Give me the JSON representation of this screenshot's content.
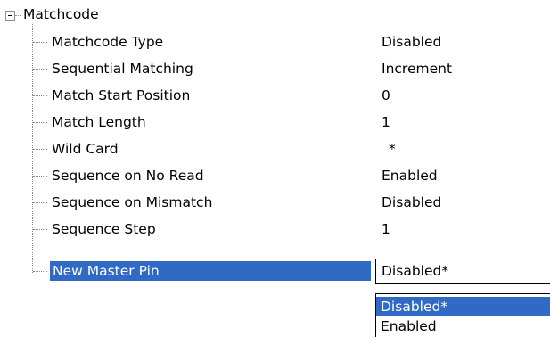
{
  "tree": {
    "root_label": "Matchcode",
    "items": [
      {
        "label": "Matchcode Type",
        "value": "Disabled"
      },
      {
        "label": "Sequential Matching",
        "value": "Increment"
      },
      {
        "label": "Match Start Position",
        "value": "0"
      },
      {
        "label": "Match Length",
        "value": "1"
      },
      {
        "label": "Wild Card",
        "value": "*"
      },
      {
        "label": "Sequence on No Read",
        "value": "Enabled"
      },
      {
        "label": "Sequence on Mismatch",
        "value": "Disabled"
      },
      {
        "label": "Sequence Step",
        "value": "1"
      },
      {
        "label": "New Master Pin",
        "value": ""
      }
    ]
  },
  "editor": {
    "current_value": "Disabled*",
    "options": [
      "Disabled*",
      "Enabled"
    ],
    "selected_index": 0
  },
  "colors": {
    "selection": "#316ac5",
    "selection_text": "#ffffff",
    "tree_lines": "#8a8a8a"
  }
}
